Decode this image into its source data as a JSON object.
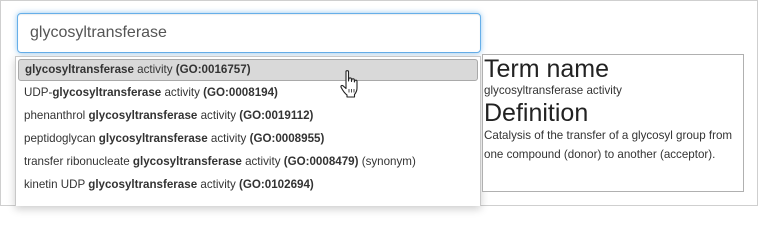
{
  "search": {
    "value": "glycosyltransferase",
    "placeholder": ""
  },
  "suggestions": [
    {
      "pre": "",
      "bold": "glycosyltransferase",
      "post": " activity ",
      "id": "(GO:0016757)",
      "extra": ""
    },
    {
      "pre": "UDP-",
      "bold": "glycosyltransferase",
      "post": " activity ",
      "id": "(GO:0008194)",
      "extra": ""
    },
    {
      "pre": "phenanthrol ",
      "bold": "glycosyltransferase",
      "post": " activity ",
      "id": "(GO:0019112)",
      "extra": ""
    },
    {
      "pre": "peptidoglycan ",
      "bold": "glycosyltransferase",
      "post": " activity ",
      "id": "(GO:0008955)",
      "extra": ""
    },
    {
      "pre": "transfer ribonucleate ",
      "bold": "glycosyltransferase",
      "post": " activity ",
      "id": "(GO:0008479)",
      "extra": " (synonym)"
    },
    {
      "pre": "kinetin UDP ",
      "bold": "glycosyltransferase",
      "post": " activity ",
      "id": "(GO:0102694)",
      "extra": ""
    }
  ],
  "panel": {
    "term_heading": "Term name",
    "term_value": "glycosyltransferase activity",
    "definition_heading": "Definition",
    "definition_value": "Catalysis of the transfer of a glycosyl group from one compound (donor) to another (acceptor)."
  },
  "icons": {
    "cursor": "hand-pointer-icon"
  }
}
